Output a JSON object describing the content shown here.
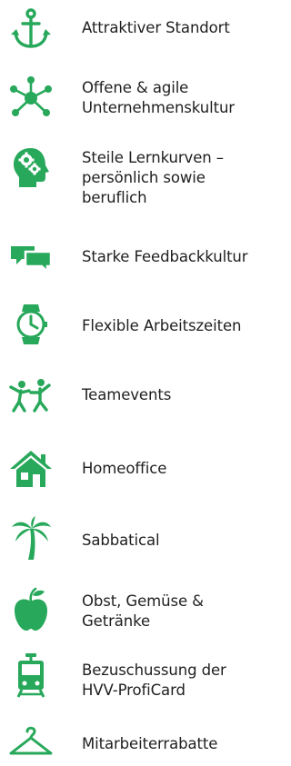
{
  "accent_color": "#27a85a",
  "benefits": [
    {
      "icon": "anchor-icon",
      "label": "Attraktiver Standort"
    },
    {
      "icon": "network-hub-icon",
      "label": "Offene & agile\nUnternehmenskultur"
    },
    {
      "icon": "head-gears-icon",
      "label": "Steile Lernkurven –\npersönlich sowie\nberuflich"
    },
    {
      "icon": "speech-bubbles-icon",
      "label": "Starke Feedbackkultur"
    },
    {
      "icon": "wristwatch-icon",
      "label": "Flexible Arbeitszeiten"
    },
    {
      "icon": "people-dancing-icon",
      "label": "Teamevents"
    },
    {
      "icon": "house-icon",
      "label": "Homeoffice"
    },
    {
      "icon": "palm-tree-icon",
      "label": "Sabbatical"
    },
    {
      "icon": "apple-icon",
      "label": "Obst, Gemüse &\nGetränke"
    },
    {
      "icon": "tram-icon",
      "label": "Bezuschussung der\nHVV-ProfiCard"
    },
    {
      "icon": "clothes-hanger-icon",
      "label": "Mitarbeiterrabatte"
    }
  ]
}
